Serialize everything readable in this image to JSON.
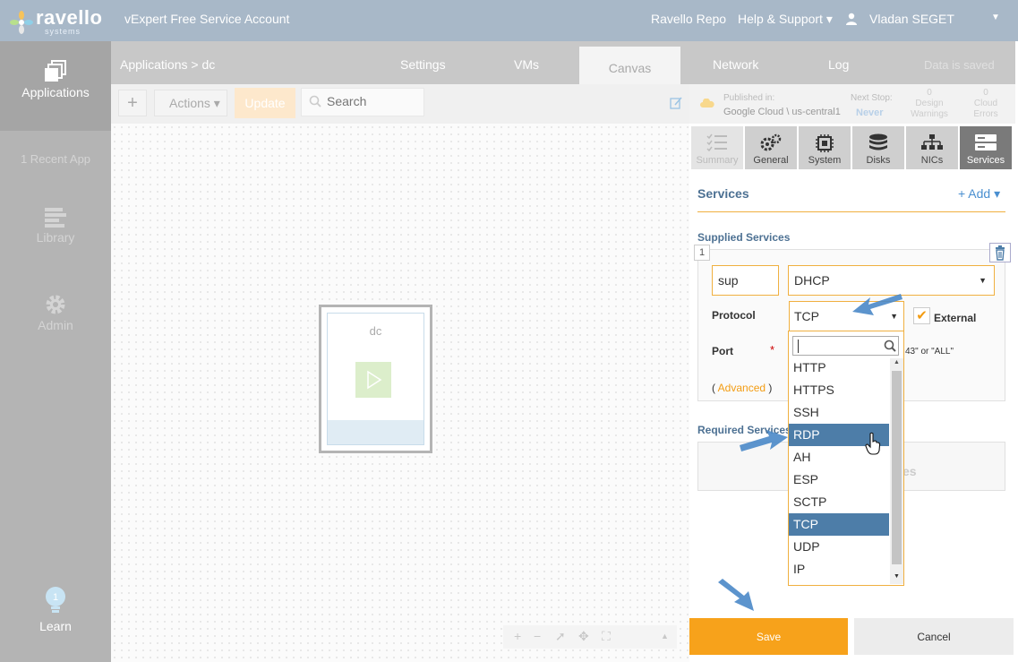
{
  "topbar": {
    "brand": "ravello",
    "brand_sub": "systems",
    "account": "vExpert Free Service Account",
    "repo": "Ravello Repo",
    "help": "Help & Support ▾",
    "user": "Vladan SEGET"
  },
  "leftnav": {
    "applications": "Applications",
    "recent": "1 Recent App",
    "library": "Library",
    "admin": "Admin",
    "learn": "Learn",
    "learn_badge": "1"
  },
  "tabs": {
    "breadcrumb": "Applications > dc",
    "settings": "Settings",
    "vms": "VMs",
    "canvas": "Canvas",
    "network": "Network",
    "log": "Log",
    "status": "Data is saved"
  },
  "toolbar": {
    "plus": "+",
    "actions": "Actions ▾",
    "update": "Update",
    "search_placeholder": "Search"
  },
  "canvas": {
    "vm_name": "dc",
    "zoom": {
      "plus": "+",
      "minus": "−"
    }
  },
  "publish": {
    "label": "Published in:",
    "value": "Google Cloud \\ us-central1",
    "next_stop_label": "Next Stop:",
    "next_stop_value": "Never",
    "design_warnings_count": "0",
    "design_warnings_label": "Design\nWarnings",
    "cloud_errors_count": "0",
    "cloud_errors_label": "Cloud\nErrors"
  },
  "side_tabs": [
    "Summary",
    "General",
    "System",
    "Disks",
    "NICs",
    "Services"
  ],
  "services": {
    "title": "Services",
    "add": "+ Add ▾",
    "supplied_title": "Supplied Services",
    "index": "1",
    "name_value": "sup",
    "type_value": "DHCP",
    "protocol_label": "Protocol",
    "protocol_value": "TCP",
    "external_label": "External",
    "port_label": "Port",
    "port_required": "*",
    "port_hint": "43\" or \"ALL\"",
    "advanced_open": "( ",
    "advanced_link": "Advanced",
    "advanced_close": " )",
    "required_title": "Required Services",
    "required_placeholder": "es"
  },
  "dropdown": {
    "options": [
      "HTTP",
      "HTTPS",
      "SSH",
      "RDP",
      "AH",
      "ESP",
      "SCTP",
      "TCP",
      "UDP",
      "IP"
    ],
    "hover_index": 3,
    "selected_index": 7
  },
  "footer": {
    "save": "Save",
    "cancel": "Cancel"
  },
  "colors": {
    "topbar": "#a8b8c8",
    "accent_orange": "#f7a21b",
    "highlight_blue": "#4d7da8",
    "section_title": "#4d7193"
  }
}
